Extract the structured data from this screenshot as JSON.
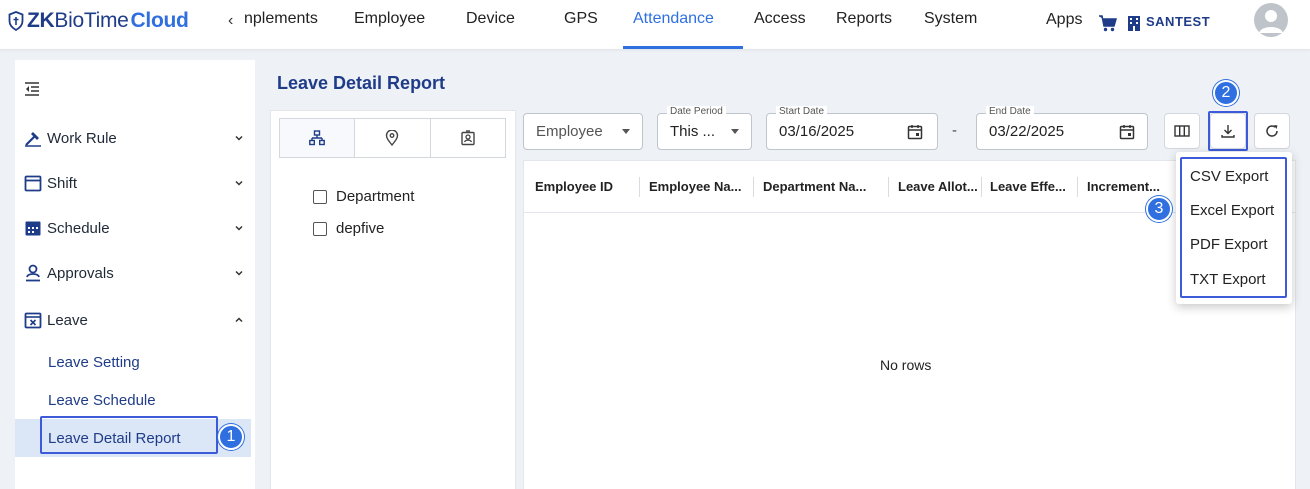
{
  "brand": {
    "part1": "ZK",
    "part2": "BioTime",
    "part3": "Cloud"
  },
  "nav": {
    "scroll_left": "‹",
    "items": [
      "nplements",
      "Employee",
      "Device",
      "GPS",
      "Attendance",
      "Access",
      "Reports",
      "System"
    ],
    "active": "Attendance",
    "apps": "Apps",
    "company": "SANTEST",
    "icons": [
      "cart-icon",
      "building-icon",
      "avatar-icon"
    ]
  },
  "sidebar": {
    "items": [
      {
        "label": "Work Rule",
        "icon": "work-rule-icon",
        "expanded": false
      },
      {
        "label": "Shift",
        "icon": "shift-icon",
        "expanded": false
      },
      {
        "label": "Schedule",
        "icon": "schedule-icon",
        "expanded": false
      },
      {
        "label": "Approvals",
        "icon": "approvals-icon",
        "expanded": false
      },
      {
        "label": "Leave",
        "icon": "leave-icon",
        "expanded": true
      }
    ],
    "sub_items": [
      "Leave Setting",
      "Leave Schedule",
      "Leave Detail Report"
    ],
    "selected": "Leave Detail Report"
  },
  "page": {
    "title": "Leave Detail Report"
  },
  "tree": {
    "tabs": [
      "department-tree-icon",
      "location-icon",
      "badge-icon"
    ],
    "nodes": [
      "Department",
      "depfive"
    ]
  },
  "filters": {
    "employee": "Employee",
    "date_period_label": "Date Period",
    "date_period_value": "This ...",
    "start_label": "Start Date",
    "start_value": "03/16/2025",
    "separator": "-",
    "end_label": "End Date",
    "end_value": "03/22/2025"
  },
  "toolbar": [
    "columns-icon",
    "download-icon",
    "refresh-icon"
  ],
  "table": {
    "columns": [
      "Employee ID",
      "Employee Na...",
      "Department Na...",
      "Leave Allot...",
      "Leave Effe...",
      "Increment..."
    ],
    "empty": "No rows"
  },
  "export_menu": [
    "CSV Export",
    "Excel Export",
    "PDF Export",
    "TXT Export"
  ],
  "callouts": [
    "1",
    "2",
    "3"
  ],
  "colors": {
    "accent": "#2f6fe0",
    "brand": "#1f3c88",
    "highlight": "#3d5bd9",
    "selected_bg": "#dbe6f7"
  }
}
